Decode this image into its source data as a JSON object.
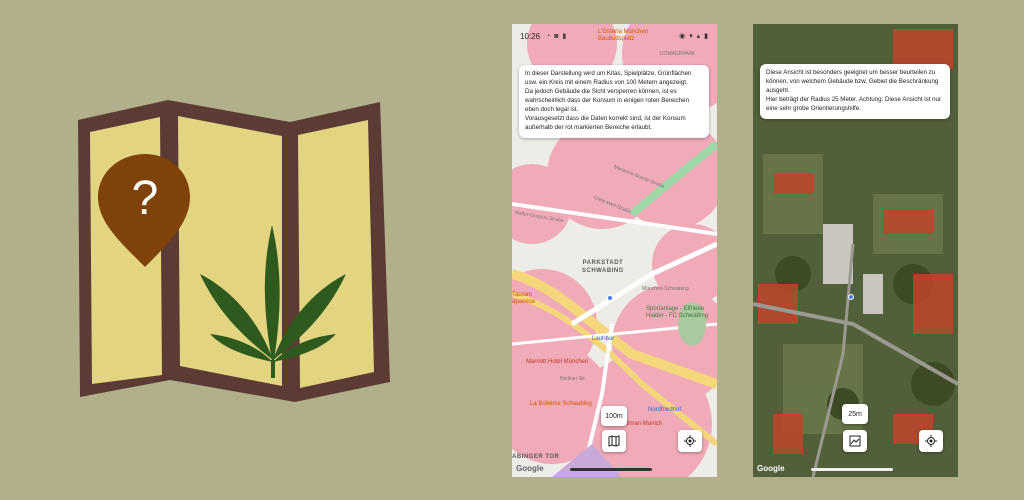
{
  "colors": {
    "background": "#b1b08b",
    "logo_frame": "#5b3b33",
    "logo_paper": "#e3d482",
    "logo_pin": "#7f4208",
    "logo_leaf": "#2f5a1e",
    "restricted_zone": "#f2a3b4"
  },
  "logo": {
    "pin_symbol": "?",
    "icon_names": [
      "folded-map-icon",
      "question-pin-icon",
      "cannabis-leaf-icon"
    ]
  },
  "map_phone": {
    "status": {
      "time": "10:26"
    },
    "poi_top": "L'Osteria München\nBaubudsplatz",
    "street_top": "DOMAGKPARK",
    "info_lines": [
      "In dieser Darstellung wird um Kitas, Spielplätze, Grünflächen usw. ein Kreis mit einem Radius von 100 Metern angezeigt.",
      "Da jedoch Gebäude die Sicht versperren können, ist es wahrscheinlich dass der Konsum in einigen roten Bereichen eben doch legal ist.",
      "Vorausgesetzt dass die Daten korrekt sind, ist der Konsum außerhalb der rot markierten Bereiche erlaubt."
    ],
    "labels": {
      "district": "PARKSTADT\nSCHWABING",
      "marriott": "Marriott Hotel München",
      "lauf_bar": "Lauf-bar",
      "sportanlage": "Sportanlage - Elfriede\nHaider - FC Schwabing",
      "boheme": "La Bohème Schwabing",
      "tullman": "Tullman Munich",
      "nordfriedhof": "Nordfriedhof",
      "tor": "ABINGER TOR",
      "osteria_left": "Taurant\napanese",
      "street_1": "Marianne-Brandt-Straße",
      "street_2": "Grete-Weil-Straße",
      "street_3": "Walter-Gropius-Straße",
      "street_4": "Berliner Str.",
      "station": "München-Schwabing"
    },
    "scale_label": "100m",
    "google": "Google"
  },
  "sat_phone": {
    "info_lines": [
      "Diese Ansicht ist besonders geeignet um besser beurteilen zu können, von welchem Gebäude bzw. Gebiet die Beschränkung ausgeht.",
      "Hier beträgt der Radius 25 Meter. Achtung: Diese Ansicht ist nur eine sehr grobe Orientierungshilfe."
    ],
    "scale_label": "25m",
    "google": "Google"
  }
}
